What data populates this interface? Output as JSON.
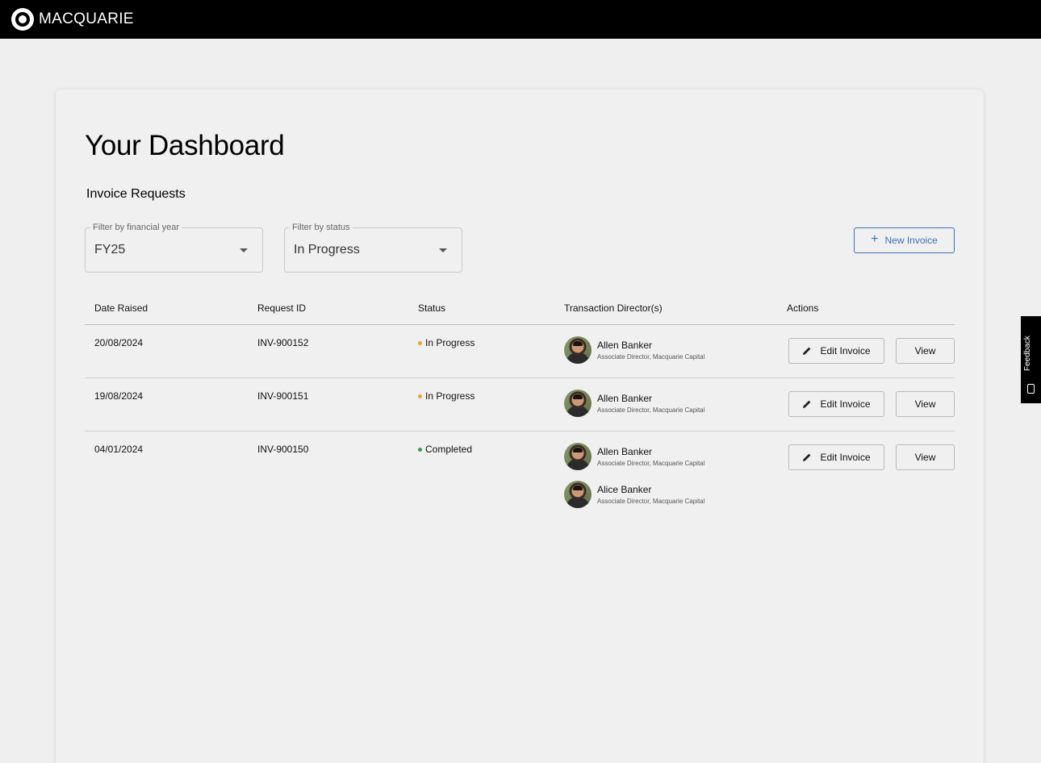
{
  "brand": {
    "name": "MACQUARIE",
    "icon": "macquarie-ring-logo"
  },
  "page": {
    "title": "Your Dashboard",
    "section": "Invoice Requests"
  },
  "filters": {
    "year": {
      "label": "Filter by financial year",
      "value": "FY25"
    },
    "status": {
      "label": "Filter by status",
      "value": "In Progress"
    }
  },
  "new_invoice": {
    "label": "New Invoice",
    "icon": "plus-icon"
  },
  "table": {
    "headers": [
      "Date Raised",
      "Request ID",
      "Status",
      "Transaction Director(s)",
      "Actions"
    ],
    "rows": [
      {
        "date": "20/08/2024",
        "id": "INV-900152",
        "status": "In Progress",
        "status_color": "#f0a030",
        "directors": [
          {
            "name": "Allen Banker",
            "role": "Associate Director, Macquarie Capital"
          }
        ],
        "edit_label": "Edit Invoice",
        "view_label": "View"
      },
      {
        "date": "19/08/2024",
        "id": "INV-900151",
        "status": "In Progress",
        "status_color": "#f0a030",
        "directors": [
          {
            "name": "Allen Banker",
            "role": "Associate Director, Macquarie Capital"
          }
        ],
        "edit_label": "Edit Invoice",
        "view_label": "View"
      },
      {
        "date": "04/01/2024",
        "id": "INV-900150",
        "status": "Completed",
        "status_color": "#3a9a4a",
        "directors": [
          {
            "name": "Allen Banker",
            "role": "Associate Director, Macquarie Capital"
          },
          {
            "name": "Alice Banker",
            "role": "Associate Director, Macquarie Capital"
          }
        ],
        "edit_label": "Edit Invoice",
        "view_label": "View"
      }
    ]
  },
  "feedback": {
    "label": "Feedback",
    "icon": "feedback-icon"
  },
  "colors": {
    "accent": "#3d6fb6",
    "topbar": "#000000",
    "background": "#efefef"
  }
}
